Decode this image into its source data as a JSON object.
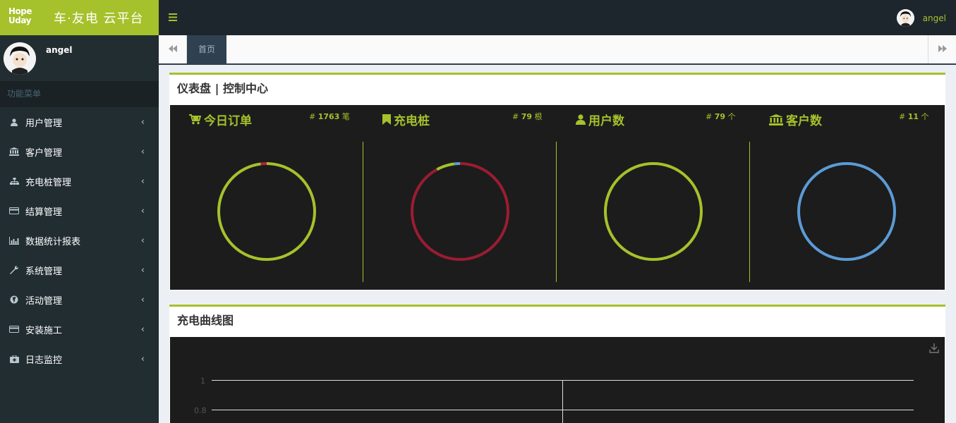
{
  "app": {
    "logo_line1": "Hope",
    "logo_line2": "Uday",
    "title": "车·友电 云平台"
  },
  "topbar": {
    "menu_toggle_icon": "hamburger-icon",
    "user_name": "angel"
  },
  "sidebar": {
    "user_name": "angel",
    "menu_header": "功能菜单",
    "items": [
      {
        "label": "用户管理",
        "icon": "user-icon"
      },
      {
        "label": "客户管理",
        "icon": "bank-icon"
      },
      {
        "label": "充电桩管理",
        "icon": "sitemap-icon"
      },
      {
        "label": "结算管理",
        "icon": "credit-card-icon"
      },
      {
        "label": "数据统计报表",
        "icon": "bar-chart-icon"
      },
      {
        "label": "系统管理",
        "icon": "wrench-icon"
      },
      {
        "label": "活动管理",
        "icon": "globe-icon"
      },
      {
        "label": "安装施工",
        "icon": "credit-card-icon"
      },
      {
        "label": "日志监控",
        "icon": "medkit-icon"
      }
    ]
  },
  "tabs": {
    "home_label": "首页"
  },
  "dashboard": {
    "title": "仪表盘 | 控制中心",
    "stats": [
      {
        "label": "今日订单",
        "icon": "cart-plus-icon",
        "count": "1763",
        "unit": "笔",
        "ring": {
          "main_color": "#a5c12b",
          "segments": [
            {
              "color": "#a5c12b",
              "fraction": 0.98
            },
            {
              "color": "#b0233a",
              "fraction": 0.02
            }
          ]
        }
      },
      {
        "label": "充电桩",
        "icon": "bookmark-icon",
        "count": "79",
        "unit": "根",
        "ring": {
          "main_color": "#9b1c32",
          "segments": [
            {
              "color": "#9b1c32",
              "fraction": 0.92
            },
            {
              "color": "#a5c12b",
              "fraction": 0.06
            },
            {
              "color": "#5b9bd5",
              "fraction": 0.02
            }
          ]
        }
      },
      {
        "label": "用户数",
        "icon": "user-icon",
        "count": "79",
        "unit": "个",
        "ring": {
          "main_color": "#a5c12b",
          "segments": [
            {
              "color": "#a5c12b",
              "fraction": 1.0
            }
          ]
        }
      },
      {
        "label": "客户数",
        "icon": "bank-icon",
        "count": "11",
        "unit": "个",
        "ring": {
          "main_color": "#5b9bd5",
          "segments": [
            {
              "color": "#5b9bd5",
              "fraction": 1.0
            }
          ]
        }
      }
    ]
  },
  "chart_box": {
    "title": "充电曲线图",
    "download_icon": "download-icon",
    "y_ticks": [
      "1",
      "0.8"
    ]
  },
  "colors": {
    "accent": "#a5c12b",
    "sidebar_bg": "#222d32",
    "topbar_bg": "#1e262d",
    "panel_bg": "#1c1c1c"
  }
}
